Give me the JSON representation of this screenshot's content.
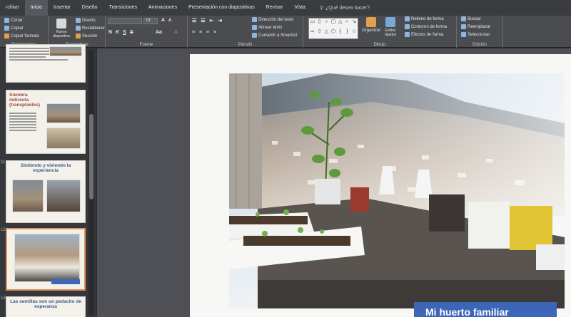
{
  "ribbon": {
    "tabs": [
      "rchivo",
      "Inicio",
      "Insertar",
      "Diseño",
      "Transiciones",
      "Animaciones",
      "Presentación con diapositivas",
      "Revisar",
      "Vista"
    ],
    "active_tab": "Inicio",
    "search_placeholder": "¿Qué desea hacer?",
    "clipboard": {
      "cut": "Cortar",
      "copy": "Copiar",
      "format_painter": "Copiar formato",
      "label": "Portapapeles"
    },
    "slides": {
      "new_slide": "Nueva diapositiva",
      "layout": "Diseño",
      "reset": "Restablecer",
      "section": "Sección",
      "label": "Diapositivas"
    },
    "font": {
      "font_name": "",
      "font_size": "18",
      "label": "Fuente",
      "bold": "N",
      "italic": "K",
      "underline": "S",
      "strike": "S",
      "grow": "A",
      "shrink": "A",
      "aa": "Aa"
    },
    "paragraph": {
      "text_direction": "Dirección del texto",
      "align_text": "Alinear texto",
      "smartart": "Convertir a SmartArt",
      "label": "Párrafo"
    },
    "drawing": {
      "arrange": "Organizar",
      "quick_styles": "Estilos rápidos",
      "fill": "Relleno de forma",
      "outline": "Contorno de forma",
      "effects": "Efectos de forma",
      "label": "Dibujo"
    },
    "editing": {
      "find": "Buscar",
      "replace": "Reemplazar",
      "select": "Seleccionar",
      "label": "Edición"
    }
  },
  "slides_panel": {
    "items": [
      {
        "number": "",
        "title": ""
      },
      {
        "number": "",
        "title": "Siembra indirecta (transplantes)"
      },
      {
        "number": "11",
        "title": "Sintiendo y viviendo la experiencia"
      },
      {
        "number": "12",
        "title": ""
      },
      {
        "number": "13",
        "title": "Las semillas son un pedacito de esperanza"
      }
    ]
  },
  "slide": {
    "caption": "Mi huerto familiar"
  }
}
